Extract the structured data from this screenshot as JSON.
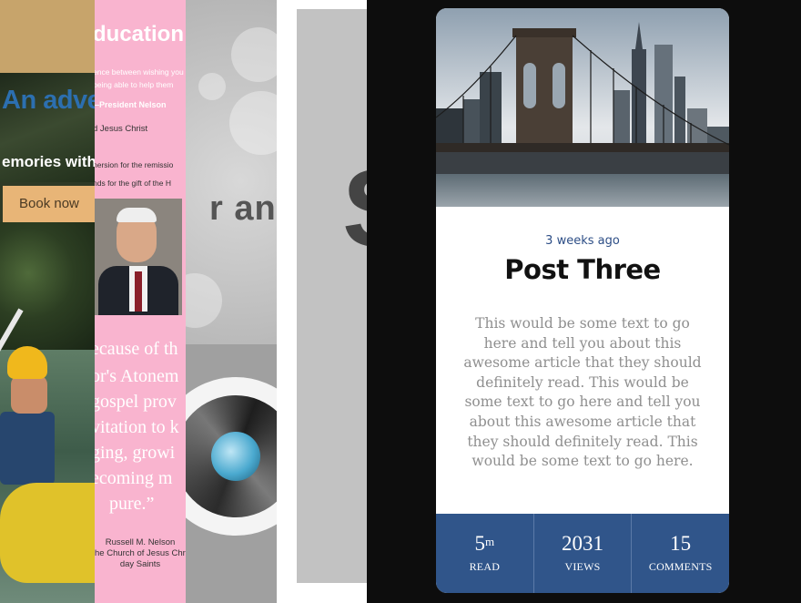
{
  "background": {
    "strip1": {
      "headline": "An adventure",
      "tagline": "emories with",
      "book_button": "Book now"
    },
    "strip2": {
      "heading": "ducation",
      "line1": "ence between wishing you c",
      "line2": "being able to help them",
      "attribution": "—President Nelson",
      "line3": "d Jesus Christ",
      "line4": "nersion for the remissio",
      "line5": "nds for the gift of the H",
      "quote1": "ecause of th",
      "quote2": "or's Atonem",
      "quote3": "gospel prov",
      "quote4": "vitation to k",
      "quote5": "ging, growi",
      "quote6": "ecoming m",
      "quote7": "pure.”",
      "cite1": "Russell M. Nelson",
      "cite2": "he Church of Jesus Chri",
      "cite3": "day Saints"
    },
    "strip3": {
      "text": "r and t"
    },
    "strip4": {
      "glyph": "S"
    }
  },
  "post": {
    "time_ago": "3 weeks ago",
    "title": "Post Three",
    "body": "This would be some text to go here and tell you about this awesome article that they should definitely read. This would be some text to go here and tell you about this awesome article that they should definitely read. This would be some text to go here.",
    "stats": [
      {
        "value": "5",
        "sup": "m",
        "label": "READ"
      },
      {
        "value": "2031",
        "sup": "",
        "label": "VIEWS"
      },
      {
        "value": "15",
        "sup": "",
        "label": "COMMENTS"
      }
    ]
  },
  "colors": {
    "accent": "#30558a",
    "time_text": "#2d4e86",
    "body_text": "#8f8f8f",
    "page_bg_dark": "#0d0d0d"
  }
}
